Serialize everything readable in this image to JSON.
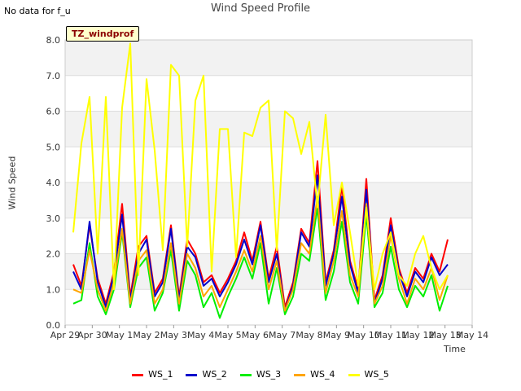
{
  "header": {
    "no_data_text": "No data for f_u"
  },
  "badge_text": "TZ_windprof",
  "chart_data": {
    "type": "line",
    "title": "Wind Speed Profile",
    "xlabel": "Time",
    "ylabel": "Wind Speed",
    "ylim": [
      0,
      8
    ],
    "yticks": [
      0.0,
      1.0,
      2.0,
      3.0,
      4.0,
      5.0,
      6.0,
      7.0,
      8.0
    ],
    "ytick_labels": [
      "0.0",
      "1.0",
      "2.0",
      "3.0",
      "4.0",
      "5.0",
      "6.0",
      "7.0",
      "8.0"
    ],
    "xlim": [
      0,
      15
    ],
    "xtick_labels": [
      "Apr 29",
      "Apr 30",
      "May 1",
      "May 2",
      "May 3",
      "May 4",
      "May 5",
      "May 6",
      "May 7",
      "May 8",
      "May 9",
      "May 10",
      "May 11",
      "May 12",
      "May 13",
      "May 14"
    ],
    "grid": true,
    "shaded_bands": true,
    "legend_position": "bottom",
    "series": [
      {
        "name": "WS_1",
        "color": "#ff0000",
        "x": [
          0.3,
          0.6,
          0.9,
          1.2,
          1.5,
          1.8,
          2.1,
          2.4,
          2.7,
          3.0,
          3.3,
          3.6,
          3.9,
          4.2,
          4.5,
          4.8,
          5.1,
          5.4,
          5.7,
          6.0,
          6.3,
          6.6,
          6.9,
          7.2,
          7.5,
          7.8,
          8.1,
          8.4,
          8.7,
          9.0,
          9.3,
          9.6,
          9.9,
          10.2,
          10.5,
          10.8,
          11.1,
          11.4,
          11.7,
          12.0,
          12.3,
          12.6,
          12.9,
          13.2,
          13.5,
          13.8,
          14.1
        ],
        "values": [
          1.7,
          1.1,
          2.8,
          1.3,
          0.6,
          1.5,
          3.4,
          0.8,
          2.2,
          2.5,
          0.9,
          1.3,
          2.8,
          0.8,
          2.4,
          2.0,
          1.2,
          1.4,
          0.9,
          1.3,
          1.8,
          2.6,
          1.8,
          2.9,
          1.3,
          2.2,
          0.5,
          1.2,
          2.7,
          2.3,
          4.6,
          1.2,
          2.1,
          3.9,
          1.8,
          1.0,
          4.1,
          0.7,
          1.4,
          3.0,
          1.6,
          0.9,
          1.6,
          1.3,
          2.0,
          1.5,
          2.4
        ]
      },
      {
        "name": "WS_2",
        "color": "#0000cc",
        "x": [
          0.3,
          0.6,
          0.9,
          1.2,
          1.5,
          1.8,
          2.1,
          2.4,
          2.7,
          3.0,
          3.3,
          3.6,
          3.9,
          4.2,
          4.5,
          4.8,
          5.1,
          5.4,
          5.7,
          6.0,
          6.3,
          6.6,
          6.9,
          7.2,
          7.5,
          7.8,
          8.1,
          8.4,
          8.7,
          9.0,
          9.3,
          9.6,
          9.9,
          10.2,
          10.5,
          10.8,
          11.1,
          11.4,
          11.7,
          12.0,
          12.3,
          12.6,
          12.9,
          13.2,
          13.5,
          13.8,
          14.1
        ],
        "values": [
          1.5,
          1.0,
          2.9,
          1.2,
          0.5,
          1.4,
          3.1,
          0.7,
          2.0,
          2.4,
          0.8,
          1.2,
          2.7,
          0.7,
          2.2,
          1.9,
          1.1,
          1.3,
          0.8,
          1.2,
          1.7,
          2.4,
          1.7,
          2.8,
          1.2,
          2.0,
          0.4,
          1.1,
          2.6,
          2.2,
          4.2,
          1.1,
          2.0,
          3.6,
          1.7,
          0.9,
          3.8,
          0.6,
          1.3,
          2.8,
          1.5,
          0.8,
          1.5,
          1.2,
          1.9,
          1.4,
          1.7
        ]
      },
      {
        "name": "WS_3",
        "color": "#00ee00",
        "x": [
          0.3,
          0.6,
          0.9,
          1.2,
          1.5,
          1.8,
          2.1,
          2.4,
          2.7,
          3.0,
          3.3,
          3.6,
          3.9,
          4.2,
          4.5,
          4.8,
          5.1,
          5.4,
          5.7,
          6.0,
          6.3,
          6.6,
          6.9,
          7.2,
          7.5,
          7.8,
          8.1,
          8.4,
          8.7,
          9.0,
          9.3,
          9.6,
          9.9,
          10.2,
          10.5,
          10.8,
          11.1,
          11.4,
          11.7,
          12.0,
          12.3,
          12.6,
          12.9,
          13.2,
          13.5,
          13.8,
          14.1
        ],
        "values": [
          0.6,
          0.7,
          2.3,
          0.8,
          0.3,
          1.0,
          2.6,
          0.5,
          1.6,
          1.9,
          0.4,
          0.9,
          2.1,
          0.4,
          1.8,
          1.4,
          0.5,
          0.9,
          0.2,
          0.8,
          1.3,
          1.9,
          1.3,
          2.3,
          0.6,
          1.6,
          0.3,
          0.8,
          2.0,
          1.8,
          3.3,
          0.7,
          1.5,
          2.9,
          1.2,
          0.6,
          3.1,
          0.5,
          0.9,
          2.2,
          1.0,
          0.5,
          1.1,
          0.8,
          1.4,
          0.4,
          1.1
        ]
      },
      {
        "name": "WS_4",
        "color": "#ffa500",
        "x": [
          0.3,
          0.6,
          0.9,
          1.2,
          1.5,
          1.8,
          2.1,
          2.4,
          2.7,
          3.0,
          3.3,
          3.6,
          3.9,
          4.2,
          4.5,
          4.8,
          5.1,
          5.4,
          5.7,
          6.0,
          6.3,
          6.6,
          6.9,
          7.2,
          7.5,
          7.8,
          8.1,
          8.4,
          8.7,
          9.0,
          9.3,
          9.6,
          9.9,
          10.2,
          10.5,
          10.8,
          11.1,
          11.4,
          11.7,
          12.0,
          12.3,
          12.6,
          12.9,
          13.2,
          13.5,
          13.8,
          14.1
        ],
        "values": [
          1.0,
          0.9,
          2.1,
          1.0,
          0.4,
          1.2,
          2.7,
          0.6,
          1.8,
          2.1,
          0.6,
          1.0,
          2.3,
          0.6,
          2.0,
          1.6,
          0.8,
          1.1,
          0.5,
          1.0,
          1.5,
          2.1,
          1.5,
          2.5,
          1.0,
          1.8,
          0.4,
          1.0,
          2.3,
          2.0,
          3.6,
          0.9,
          1.8,
          3.2,
          1.4,
          0.8,
          3.4,
          0.6,
          1.1,
          2.5,
          1.3,
          0.6,
          1.3,
          1.0,
          1.6,
          0.7,
          1.4
        ]
      },
      {
        "name": "WS_5",
        "color": "#ffff00",
        "x": [
          0.3,
          0.6,
          0.9,
          1.2,
          1.5,
          1.8,
          2.1,
          2.4,
          2.7,
          3.0,
          3.3,
          3.6,
          3.9,
          4.2,
          4.5,
          4.8,
          5.1,
          5.4,
          5.7,
          6.0,
          6.3,
          6.6,
          6.9,
          7.2,
          7.5,
          7.8,
          8.1,
          8.4,
          8.7,
          9.0,
          9.3,
          9.6,
          9.9,
          10.2,
          10.5,
          10.8,
          11.1,
          11.4,
          11.7,
          12.0,
          12.3,
          12.6,
          12.9,
          13.2,
          13.5,
          13.8,
          14.1
        ],
        "values": [
          2.6,
          5.1,
          6.4,
          2.0,
          6.4,
          1.0,
          6.1,
          7.9,
          1.4,
          6.9,
          4.9,
          2.1,
          7.3,
          7.0,
          2.2,
          6.3,
          7.0,
          1.5,
          5.5,
          5.5,
          1.9,
          5.4,
          5.3,
          6.1,
          6.3,
          2.1,
          6.0,
          5.8,
          4.8,
          5.7,
          3.3,
          5.9,
          2.8,
          4.0,
          2.6,
          1.1,
          3.3,
          1.0,
          2.0,
          2.6,
          1.4,
          1.1,
          2.0,
          2.5,
          1.6,
          1.0,
          1.4
        ]
      }
    ]
  }
}
